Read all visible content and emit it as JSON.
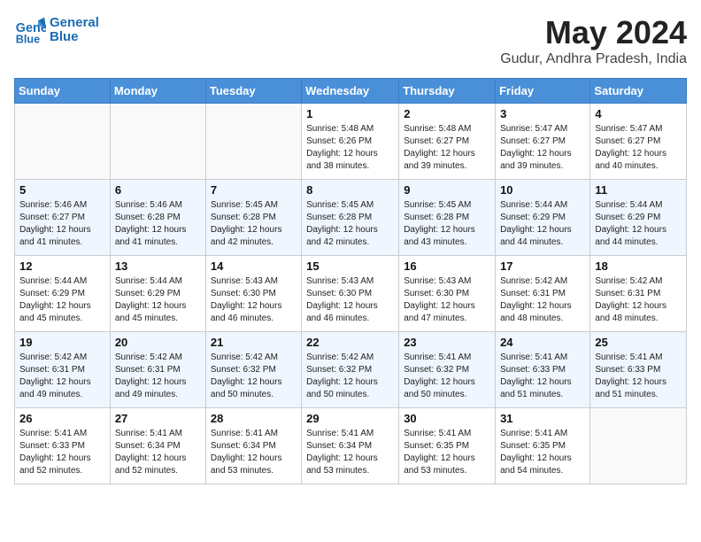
{
  "header": {
    "logo_line1": "General",
    "logo_line2": "Blue",
    "month_title": "May 2024",
    "location": "Gudur, Andhra Pradesh, India"
  },
  "weekdays": [
    "Sunday",
    "Monday",
    "Tuesday",
    "Wednesday",
    "Thursday",
    "Friday",
    "Saturday"
  ],
  "weeks": [
    [
      {
        "day": "",
        "info": ""
      },
      {
        "day": "",
        "info": ""
      },
      {
        "day": "",
        "info": ""
      },
      {
        "day": "1",
        "info": "Sunrise: 5:48 AM\nSunset: 6:26 PM\nDaylight: 12 hours\nand 38 minutes."
      },
      {
        "day": "2",
        "info": "Sunrise: 5:48 AM\nSunset: 6:27 PM\nDaylight: 12 hours\nand 39 minutes."
      },
      {
        "day": "3",
        "info": "Sunrise: 5:47 AM\nSunset: 6:27 PM\nDaylight: 12 hours\nand 39 minutes."
      },
      {
        "day": "4",
        "info": "Sunrise: 5:47 AM\nSunset: 6:27 PM\nDaylight: 12 hours\nand 40 minutes."
      }
    ],
    [
      {
        "day": "5",
        "info": "Sunrise: 5:46 AM\nSunset: 6:27 PM\nDaylight: 12 hours\nand 41 minutes."
      },
      {
        "day": "6",
        "info": "Sunrise: 5:46 AM\nSunset: 6:28 PM\nDaylight: 12 hours\nand 41 minutes."
      },
      {
        "day": "7",
        "info": "Sunrise: 5:45 AM\nSunset: 6:28 PM\nDaylight: 12 hours\nand 42 minutes."
      },
      {
        "day": "8",
        "info": "Sunrise: 5:45 AM\nSunset: 6:28 PM\nDaylight: 12 hours\nand 42 minutes."
      },
      {
        "day": "9",
        "info": "Sunrise: 5:45 AM\nSunset: 6:28 PM\nDaylight: 12 hours\nand 43 minutes."
      },
      {
        "day": "10",
        "info": "Sunrise: 5:44 AM\nSunset: 6:29 PM\nDaylight: 12 hours\nand 44 minutes."
      },
      {
        "day": "11",
        "info": "Sunrise: 5:44 AM\nSunset: 6:29 PM\nDaylight: 12 hours\nand 44 minutes."
      }
    ],
    [
      {
        "day": "12",
        "info": "Sunrise: 5:44 AM\nSunset: 6:29 PM\nDaylight: 12 hours\nand 45 minutes."
      },
      {
        "day": "13",
        "info": "Sunrise: 5:44 AM\nSunset: 6:29 PM\nDaylight: 12 hours\nand 45 minutes."
      },
      {
        "day": "14",
        "info": "Sunrise: 5:43 AM\nSunset: 6:30 PM\nDaylight: 12 hours\nand 46 minutes."
      },
      {
        "day": "15",
        "info": "Sunrise: 5:43 AM\nSunset: 6:30 PM\nDaylight: 12 hours\nand 46 minutes."
      },
      {
        "day": "16",
        "info": "Sunrise: 5:43 AM\nSunset: 6:30 PM\nDaylight: 12 hours\nand 47 minutes."
      },
      {
        "day": "17",
        "info": "Sunrise: 5:42 AM\nSunset: 6:31 PM\nDaylight: 12 hours\nand 48 minutes."
      },
      {
        "day": "18",
        "info": "Sunrise: 5:42 AM\nSunset: 6:31 PM\nDaylight: 12 hours\nand 48 minutes."
      }
    ],
    [
      {
        "day": "19",
        "info": "Sunrise: 5:42 AM\nSunset: 6:31 PM\nDaylight: 12 hours\nand 49 minutes."
      },
      {
        "day": "20",
        "info": "Sunrise: 5:42 AM\nSunset: 6:31 PM\nDaylight: 12 hours\nand 49 minutes."
      },
      {
        "day": "21",
        "info": "Sunrise: 5:42 AM\nSunset: 6:32 PM\nDaylight: 12 hours\nand 50 minutes."
      },
      {
        "day": "22",
        "info": "Sunrise: 5:42 AM\nSunset: 6:32 PM\nDaylight: 12 hours\nand 50 minutes."
      },
      {
        "day": "23",
        "info": "Sunrise: 5:41 AM\nSunset: 6:32 PM\nDaylight: 12 hours\nand 50 minutes."
      },
      {
        "day": "24",
        "info": "Sunrise: 5:41 AM\nSunset: 6:33 PM\nDaylight: 12 hours\nand 51 minutes."
      },
      {
        "day": "25",
        "info": "Sunrise: 5:41 AM\nSunset: 6:33 PM\nDaylight: 12 hours\nand 51 minutes."
      }
    ],
    [
      {
        "day": "26",
        "info": "Sunrise: 5:41 AM\nSunset: 6:33 PM\nDaylight: 12 hours\nand 52 minutes."
      },
      {
        "day": "27",
        "info": "Sunrise: 5:41 AM\nSunset: 6:34 PM\nDaylight: 12 hours\nand 52 minutes."
      },
      {
        "day": "28",
        "info": "Sunrise: 5:41 AM\nSunset: 6:34 PM\nDaylight: 12 hours\nand 53 minutes."
      },
      {
        "day": "29",
        "info": "Sunrise: 5:41 AM\nSunset: 6:34 PM\nDaylight: 12 hours\nand 53 minutes."
      },
      {
        "day": "30",
        "info": "Sunrise: 5:41 AM\nSunset: 6:35 PM\nDaylight: 12 hours\nand 53 minutes."
      },
      {
        "day": "31",
        "info": "Sunrise: 5:41 AM\nSunset: 6:35 PM\nDaylight: 12 hours\nand 54 minutes."
      },
      {
        "day": "",
        "info": ""
      }
    ]
  ]
}
